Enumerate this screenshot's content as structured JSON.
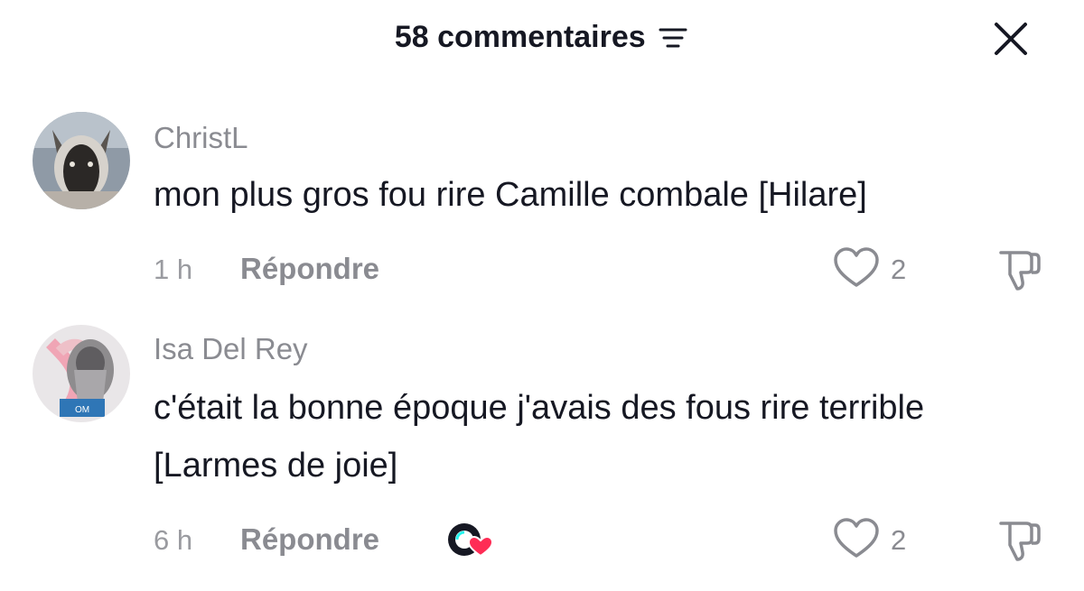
{
  "header": {
    "title": "58 commentaires",
    "filter_icon": "filter-lines-icon",
    "close_icon": "close-icon"
  },
  "comments": [
    {
      "username": "ChristL",
      "text": "mon plus gros fou rire Camille combale [Hilare]",
      "time": "1 h",
      "reply_label": "Répondre",
      "likes": "2",
      "avatar": "dog-photo",
      "creator_liked": false
    },
    {
      "username": "Isa Del Rey",
      "text": "c'était la bonne époque j'avais des fous rire terrible [Larmes de joie]",
      "time": "6 h",
      "reply_label": "Répondre",
      "likes": "2",
      "avatar": "pink-ribbon-statue-photo",
      "creator_liked": true
    }
  ],
  "colors": {
    "primary_text": "#161823",
    "secondary_text": "#8a8b91",
    "liked_heart": "#fe2c55"
  }
}
